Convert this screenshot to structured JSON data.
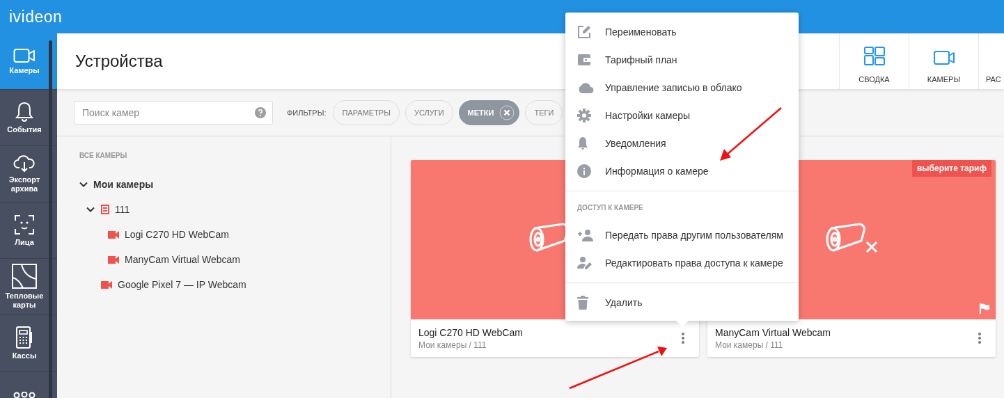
{
  "logo": "ivideon",
  "sidebar": {
    "items": [
      {
        "label": "Камеры",
        "kind": "camera",
        "selected": true
      },
      {
        "label": "События",
        "kind": "bell",
        "selected": false
      },
      {
        "label": "Экспорт архива",
        "kind": "cloud",
        "selected": false
      },
      {
        "label": "Лица",
        "kind": "face",
        "selected": false
      },
      {
        "label": "Тепловые карты",
        "kind": "heatmap",
        "selected": false
      },
      {
        "label": "Кассы",
        "kind": "register",
        "selected": false
      },
      {
        "kind": "people",
        "selected": false
      }
    ]
  },
  "header": {
    "title": "Устройства",
    "nav": [
      {
        "label": "СВОДКА",
        "kind": "grid"
      },
      {
        "label": "КАМЕРЫ",
        "kind": "camera"
      },
      {
        "label": "РАС",
        "kind": "cut"
      }
    ]
  },
  "search": {
    "placeholder": "Поиск камер"
  },
  "filters": {
    "label": "ФИЛЬТРЫ:",
    "chips": [
      {
        "label": "ПАРАМЕТРЫ",
        "selected": false
      },
      {
        "label": "УСЛУГИ",
        "selected": false
      },
      {
        "label": "МЕТКИ",
        "selected": true
      },
      {
        "label": "ТЕГИ",
        "selected": false
      }
    ]
  },
  "tree": {
    "title": "ВСЕ КАМЕРЫ",
    "nodes": [
      {
        "label": "Мои камеры",
        "kind": "folder",
        "expanded": true,
        "children": [
          {
            "label": "111",
            "kind": "group",
            "expanded": true,
            "children": [
              {
                "label": "Logi C270 HD WebCam",
                "kind": "camera"
              },
              {
                "label": "ManyCam Virtual Webcam",
                "kind": "camera"
              }
            ]
          },
          {
            "label": "Google Pixel 7 — IP Webcam",
            "kind": "camera"
          }
        ]
      }
    ]
  },
  "cards": [
    {
      "title": "Logi C270 HD WebCam",
      "path": "Мои камеры / 111"
    },
    {
      "title": "ManyCam Virtual Webcam",
      "path": "Мои камеры / 111",
      "crossed": true,
      "badge": "выберите тариф",
      "flag": true
    }
  ],
  "menu": {
    "groups": [
      {
        "items": [
          {
            "label": "Переименовать",
            "kind": "edit"
          },
          {
            "label": "Тарифный план",
            "kind": "wallet"
          },
          {
            "label": "Управление записью в облако",
            "kind": "cloud"
          },
          {
            "label": "Настройки камеры",
            "kind": "gear"
          },
          {
            "label": "Уведомления",
            "kind": "bell"
          },
          {
            "label": "Информация о камере",
            "kind": "info"
          }
        ]
      },
      {
        "title": "ДОСТУП К КАМЕРЕ",
        "items": [
          {
            "label": "Передать права другим пользователям",
            "kind": "add-user"
          },
          {
            "label": "Редактировать права доступа к камере",
            "kind": "edit-user"
          }
        ]
      },
      {
        "items": [
          {
            "label": "Удалить",
            "kind": "trash"
          }
        ]
      }
    ]
  }
}
